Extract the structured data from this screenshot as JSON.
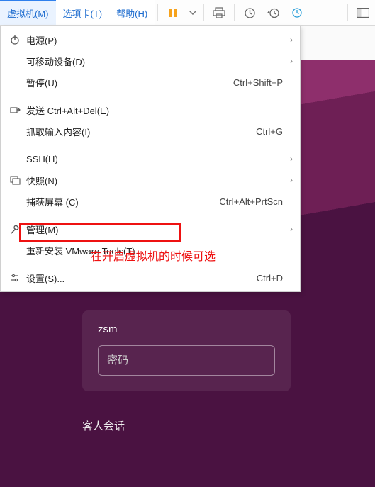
{
  "menubar": {
    "vm": "虚拟机(M)",
    "tabs": "选项卡(T)",
    "help": "帮助(H)"
  },
  "menu": {
    "power": "电源(P)",
    "removable": "可移动设备(D)",
    "pause": "暂停(U)",
    "pause_kbd": "Ctrl+Shift+P",
    "sendcad": "发送 Ctrl+Alt+Del(E)",
    "grab": "抓取输入内容(I)",
    "grab_kbd": "Ctrl+G",
    "ssh": "SSH(H)",
    "snapshot": "快照(N)",
    "capture": "捕获屏幕 (C)",
    "capture_kbd": "Ctrl+Alt+PrtScn",
    "manage": "管理(M)",
    "reinstall": "重新安装 VMware Tools(T)...",
    "settings": "设置(S)...",
    "settings_kbd": "Ctrl+D"
  },
  "annotation": "在开启虚拟机的时候可选",
  "login": {
    "username": "zsm",
    "password_placeholder": "密码",
    "guest": "客人会话"
  }
}
